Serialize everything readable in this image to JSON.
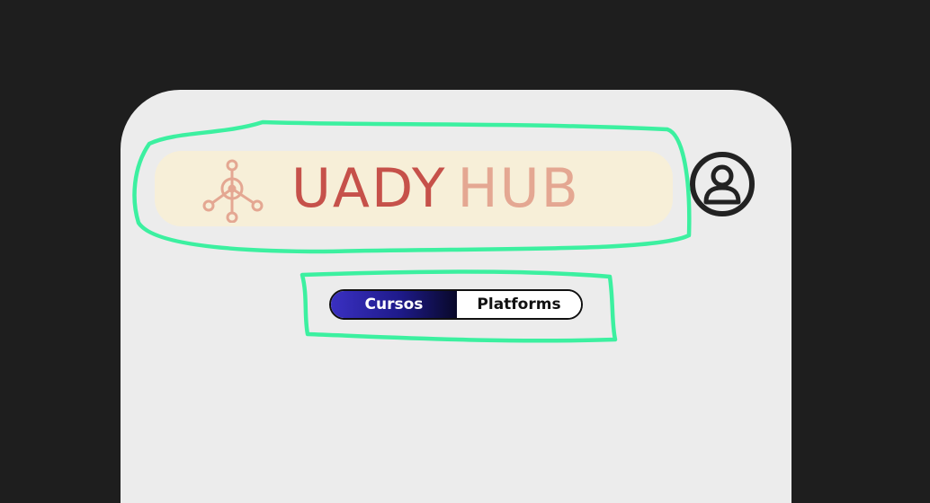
{
  "app": {
    "logo": {
      "brand_word1": "UADY",
      "brand_word2": "HUB",
      "icon": "hub-network-icon"
    },
    "profile": {
      "icon": "user-circle-icon"
    },
    "section_toggle": {
      "options": [
        {
          "label": "Cursos",
          "selected": true
        },
        {
          "label": "Platforms",
          "selected": false
        }
      ]
    }
  },
  "colors": {
    "background": "#1e1e1e",
    "panel": "#ececec",
    "logo_banner": "#f7efd8",
    "brand_primary": "#c6514a",
    "brand_secondary": "#e4a792",
    "toggle_active_start": "#3a30c2",
    "toggle_active_end": "#080828",
    "annotation": "#3cf0a0"
  }
}
